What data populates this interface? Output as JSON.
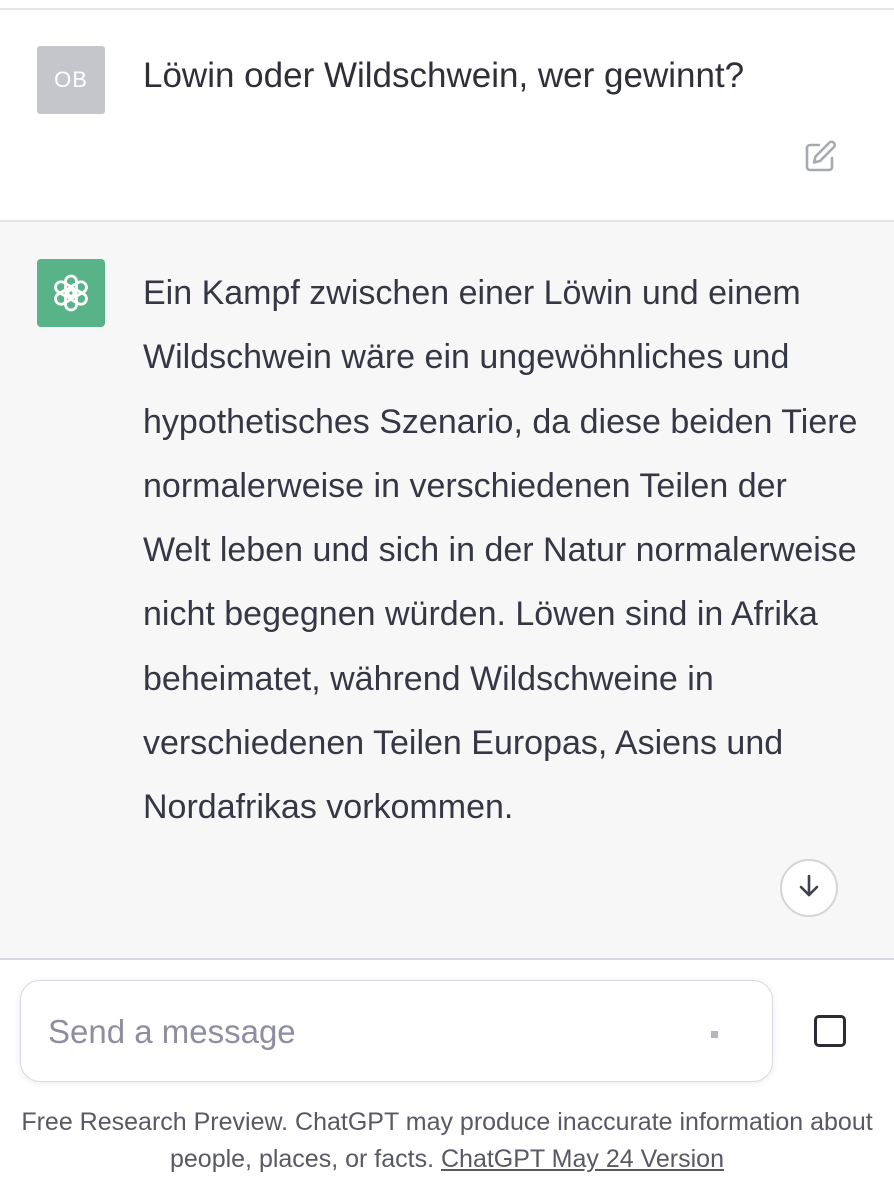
{
  "user_message": {
    "avatar_initials": "OB",
    "text": "Löwin oder Wildschwein, wer gewinnt?",
    "edit_icon": "edit-icon"
  },
  "assistant_message": {
    "avatar_icon": "openai-logo-icon",
    "text": "Ein Kampf zwischen einer Löwin und einem Wildschwein wäre ein ungewöhnliches und hypothetisches Szenario, da diese beiden Tiere normalerweise in verschiedenen Teilen der Welt leben und sich in der Natur normalerweise nicht begegnen würden. Löwen sind in Afrika beheimatet, während Wildschweine in verschiedenen Teilen Europas, Asiens und Nordafrikas vorkommen.",
    "scroll_icon": "arrow-down-icon"
  },
  "composer": {
    "placeholder": "Send a message",
    "stop_icon": "stop-square-icon"
  },
  "footer": {
    "text": "Free Research Preview. ChatGPT may produce inaccurate information about people, places, or facts.",
    "link_text": "ChatGPT May 24 Version"
  },
  "colors": {
    "assistant_background": "#f7f7f8",
    "bot_avatar": "#58b488",
    "user_avatar": "#c4c6cc"
  }
}
